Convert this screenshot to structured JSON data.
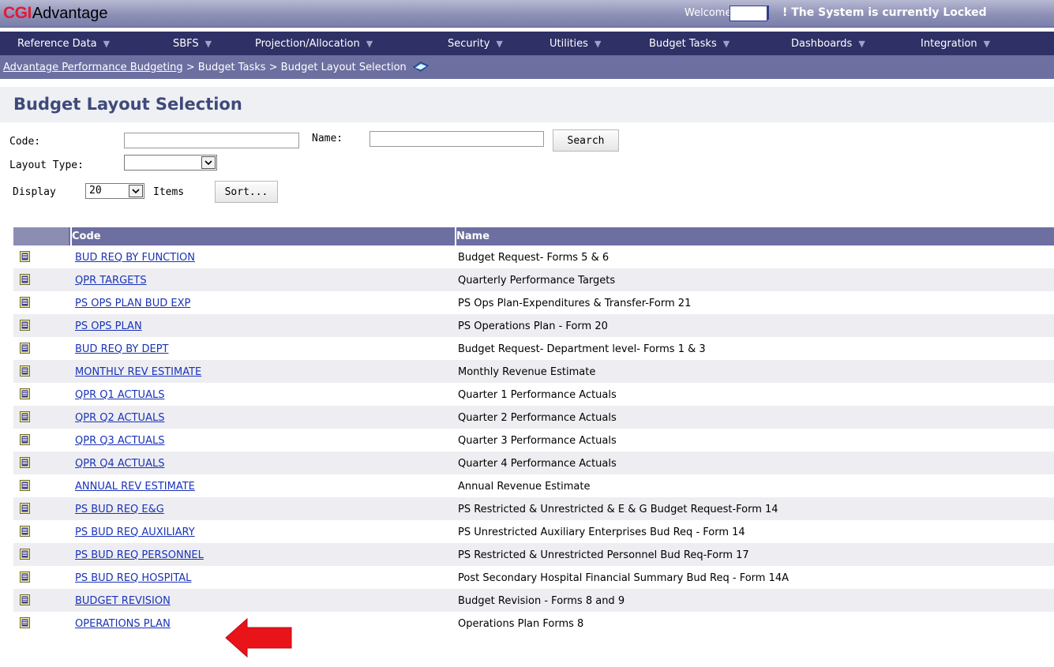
{
  "header": {
    "brand_cgi": "CGI",
    "brand_name": "Advantage",
    "welcome": "Welcome,",
    "lock_message": "! The System is currently Locked"
  },
  "menu": [
    {
      "label": "Reference Data"
    },
    {
      "label": "SBFS"
    },
    {
      "label": "Projection/Allocation"
    },
    {
      "label": "Security"
    },
    {
      "label": "Utilities"
    },
    {
      "label": "Budget Tasks"
    },
    {
      "label": "Dashboards"
    },
    {
      "label": "Integration"
    }
  ],
  "breadcrumb": {
    "root": "Advantage Performance Budgeting",
    "rest": " > Budget Tasks > Budget Layout Selection"
  },
  "page": {
    "title": "Budget Layout Selection"
  },
  "search": {
    "code_label": "Code:",
    "code_value": "",
    "name_label": "Name:",
    "name_value": "",
    "search_button": "Search",
    "layout_type_label": "Layout Type:",
    "layout_type_value": "",
    "display_label": "Display",
    "display_value": "20",
    "items_label": "Items",
    "sort_button": "Sort..."
  },
  "table": {
    "columns": [
      "Code",
      "Name"
    ],
    "rows": [
      {
        "code": "BUD REQ BY FUNCTION",
        "name": "Budget Request- Forms 5 & 6"
      },
      {
        "code": "QPR TARGETS",
        "name": "Quarterly Performance Targets"
      },
      {
        "code": "PS OPS PLAN BUD EXP",
        "name": "PS Ops Plan-Expenditures & Transfer-Form 21"
      },
      {
        "code": "PS OPS PLAN",
        "name": "PS Operations Plan - Form 20"
      },
      {
        "code": "BUD REQ BY DEPT",
        "name": "Budget Request- Department level- Forms 1 & 3"
      },
      {
        "code": "MONTHLY REV ESTIMATE",
        "name": "Monthly Revenue Estimate"
      },
      {
        "code": "QPR Q1 ACTUALS",
        "name": "Quarter 1 Performance Actuals"
      },
      {
        "code": "QPR Q2 ACTUALS",
        "name": "Quarter 2 Performance Actuals"
      },
      {
        "code": "QPR Q3 ACTUALS",
        "name": "Quarter 3 Performance Actuals"
      },
      {
        "code": "QPR Q4 ACTUALS",
        "name": "Quarter 4 Performance Actuals"
      },
      {
        "code": "ANNUAL REV ESTIMATE",
        "name": "Annual Revenue Estimate"
      },
      {
        "code": "PS BUD REQ E&G",
        "name": "PS Restricted & Unrestricted & E & G Budget Request-Form 14"
      },
      {
        "code": "PS BUD REQ AUXILIARY",
        "name": "PS Unrestricted Auxiliary Enterprises Bud Req - Form 14"
      },
      {
        "code": "PS BUD REQ PERSONNEL",
        "name": "PS Restricted & Unrestricted Personnel Bud Req-Form 17"
      },
      {
        "code": "PS BUD REQ HOSPITAL",
        "name": "Post Secondary Hospital Financial Summary Bud Req - Form 14A"
      },
      {
        "code": "BUDGET REVISION",
        "name": "Budget Revision - Forms 8 and 9"
      },
      {
        "code": "OPERATIONS PLAN",
        "name": "Operations Plan Forms 8"
      }
    ]
  },
  "colors": {
    "menubar": "#2e3066",
    "breadcrumb": "#6c6fa0",
    "title": "#3f4a7a",
    "link": "#1a33b8",
    "arrow": "#e8141a"
  },
  "icons": {
    "row": "document-icon",
    "breadcrumb": "book-icon",
    "pointer": "red-arrow-icon"
  }
}
